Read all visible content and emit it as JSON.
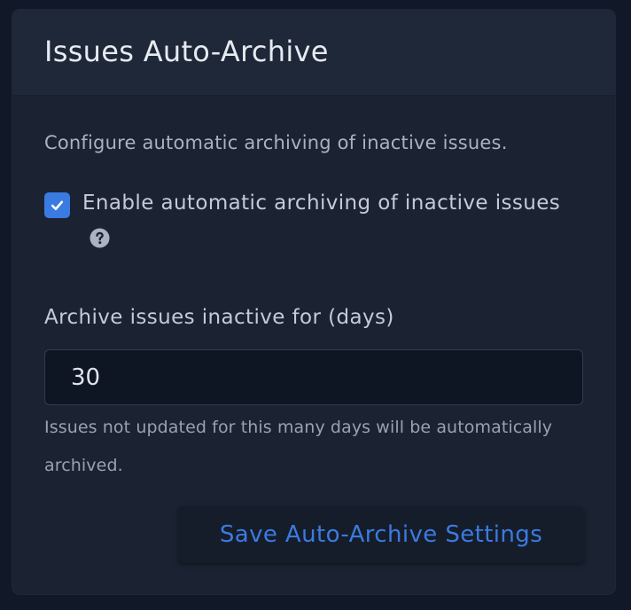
{
  "card": {
    "title": "Issues Auto-Archive",
    "description": "Configure automatic archiving of inactive issues."
  },
  "auto_archive_toggle": {
    "label": "Enable automatic archiving of inactive issues",
    "checked": true,
    "help_icon": "question-circle-icon"
  },
  "days_field": {
    "label": "Archive issues inactive for (days)",
    "value": "30",
    "help_text": "Issues not updated for this many days will be automatically archived."
  },
  "save_button": {
    "label": "Save Auto-Archive Settings"
  },
  "colors": {
    "background": "#111827",
    "card": "#1b2332",
    "accent": "#3a7be2",
    "button_text": "#3c7ae0"
  }
}
